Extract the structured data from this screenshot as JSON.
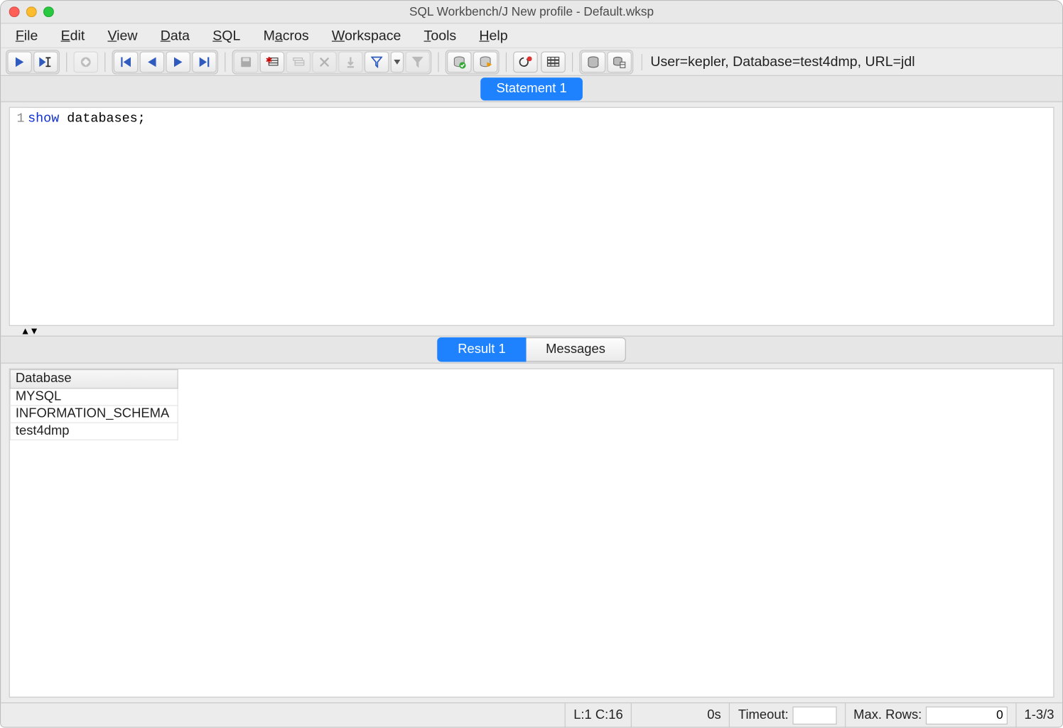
{
  "window": {
    "title": "SQL Workbench/J New profile - Default.wksp"
  },
  "menubar": {
    "items": [
      {
        "pre": "",
        "ul": "F",
        "post": "ile"
      },
      {
        "pre": "",
        "ul": "E",
        "post": "dit"
      },
      {
        "pre": "",
        "ul": "V",
        "post": "iew"
      },
      {
        "pre": "",
        "ul": "D",
        "post": "ata"
      },
      {
        "pre": "",
        "ul": "S",
        "post": "QL"
      },
      {
        "pre": "M",
        "ul": "a",
        "post": "cros"
      },
      {
        "pre": "",
        "ul": "W",
        "post": "orkspace"
      },
      {
        "pre": "",
        "ul": "T",
        "post": "ools"
      },
      {
        "pre": "",
        "ul": "H",
        "post": "elp"
      }
    ]
  },
  "toolbar": {
    "connection_text": "User=kepler, Database=test4dmp, URL=jdl"
  },
  "tabs": {
    "statement": "Statement 1",
    "result": "Result 1",
    "messages": "Messages"
  },
  "editor": {
    "line_number": "1",
    "keyword": "show",
    "rest": " databases;"
  },
  "result_table": {
    "header": "Database",
    "rows": [
      "MYSQL",
      "INFORMATION_SCHEMA",
      "test4dmp"
    ]
  },
  "statusbar": {
    "pos": "L:1 C:16",
    "time": "0s",
    "timeout_label": "Timeout:",
    "timeout_value": "",
    "maxrows_label": "Max. Rows:",
    "maxrows_value": "0",
    "rowcount": "1-3/3"
  }
}
